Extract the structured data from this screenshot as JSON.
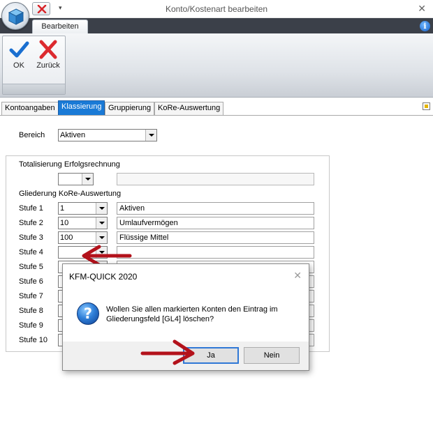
{
  "window": {
    "title": "Konto/Kostenart bearbeiten",
    "close_glyph": "✕",
    "qat_dropdown_glyph": "▾"
  },
  "icons": {
    "app_orb": "app-cube-icon",
    "qat_close": "red-x-icon",
    "info": "info-icon",
    "ok": "checkmark-icon",
    "back": "red-x-icon",
    "question": "question-icon",
    "pin": "pin-icon"
  },
  "ribbon": {
    "tab_label": "Bearbeiten",
    "ok_label": "OK",
    "back_label": "Zurück",
    "info_glyph": "i"
  },
  "page_tabs": [
    {
      "label": "Kontoangaben",
      "active": false
    },
    {
      "label": "Klassierung",
      "active": true
    },
    {
      "label": "Gruppierung",
      "active": false
    },
    {
      "label": "KoRe-Auswertung",
      "active": false
    }
  ],
  "form": {
    "bereich_label": "Bereich",
    "bereich_value": "Aktiven",
    "totalisierung_label": "Totalisierung Erfolgsrechnung",
    "totalisierung_code": "",
    "totalisierung_text": "",
    "gliederung_label": "Gliederung KoRe-Auswertung",
    "stufen": [
      {
        "label": "Stufe 1",
        "code": "1",
        "text": "Aktiven"
      },
      {
        "label": "Stufe 2",
        "code": "10",
        "text": "Umlaufvermögen"
      },
      {
        "label": "Stufe 3",
        "code": "100",
        "text": "Flüssige Mittel"
      },
      {
        "label": "Stufe 4",
        "code": "",
        "text": ""
      },
      {
        "label": "Stufe 5",
        "code": "",
        "text": ""
      },
      {
        "label": "Stufe 6",
        "code": "",
        "text": ""
      },
      {
        "label": "Stufe 7",
        "code": "",
        "text": ""
      },
      {
        "label": "Stufe 8",
        "code": "",
        "text": ""
      },
      {
        "label": "Stufe 9",
        "code": "",
        "text": ""
      },
      {
        "label": "Stufe 10",
        "code": "",
        "text": ""
      }
    ]
  },
  "dialog": {
    "title": "KFM-QUICK  2020",
    "close_glyph": "✕",
    "question_glyph": "?",
    "message_line1": "Wollen Sie allen markierten Konten den Eintrag im",
    "message_line2": "Gliederungsfeld [GL4] löschen?",
    "yes_label": "Ja",
    "no_label": "Nein"
  },
  "colors": {
    "active_tab": "#1a7ad6",
    "annotation_arrow": "#b3121b",
    "ribbon_dark": "#3b4049"
  }
}
